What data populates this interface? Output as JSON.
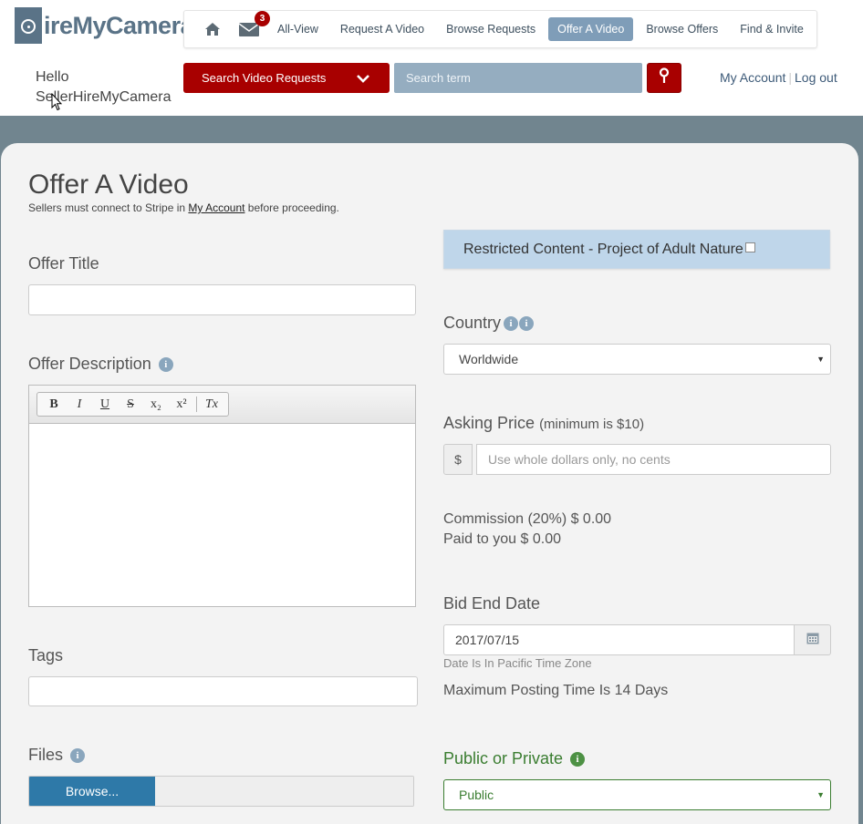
{
  "brand": {
    "logo_text": "ireMyCamera"
  },
  "nav": {
    "badge_count": "3",
    "links": [
      "All-View",
      "Request A Video",
      "Browse Requests",
      "Offer A Video",
      "Browse Offers",
      "Find & Invite"
    ],
    "active": "Offer A Video"
  },
  "user": {
    "hello": "Hello",
    "name": "SellerHireMyCamera"
  },
  "search": {
    "category_label": "Search Video Requests",
    "placeholder": "Search term"
  },
  "account": {
    "my_account": "My Account",
    "logout": "Log out"
  },
  "page": {
    "title": "Offer A Video",
    "subtitle_pre": "Sellers must connect to Stripe in",
    "subtitle_link": "My Account",
    "subtitle_post": "before proceeding."
  },
  "form": {
    "offer_title_label": "Offer Title",
    "offer_description_label": "Offer Description",
    "tags_label": "Tags",
    "files_label": "Files",
    "browse_label": "Browse...",
    "restricted_label": "Restricted Content - Project of Adult Nature",
    "country_label": "Country",
    "country_value": "Worldwide",
    "asking_price_label": "Asking Price",
    "asking_price_hint": "(minimum is $10)",
    "currency_symbol": "$",
    "price_placeholder": "Use whole dollars only, no cents",
    "commission_text": "Commission (20%) $ 0.00",
    "paid_text": "Paid to you $ 0.00",
    "bid_end_label": "Bid End Date",
    "bid_end_value": "2017/07/15",
    "timezone_note": "Date Is In Pacific Time Zone",
    "max_posting_note": "Maximum Posting Time Is 14 Days",
    "public_private_label": "Public or Private",
    "public_private_value": "Public"
  },
  "editor_toolbar": [
    "B",
    "I",
    "U",
    "S",
    "x₂",
    "x²",
    "Tx"
  ],
  "colors": {
    "brand_red": "#a80000",
    "nav_active": "#7f9db8",
    "band": "#71858f",
    "green": "#3a7d30",
    "browse_blue": "#2e79a8"
  }
}
